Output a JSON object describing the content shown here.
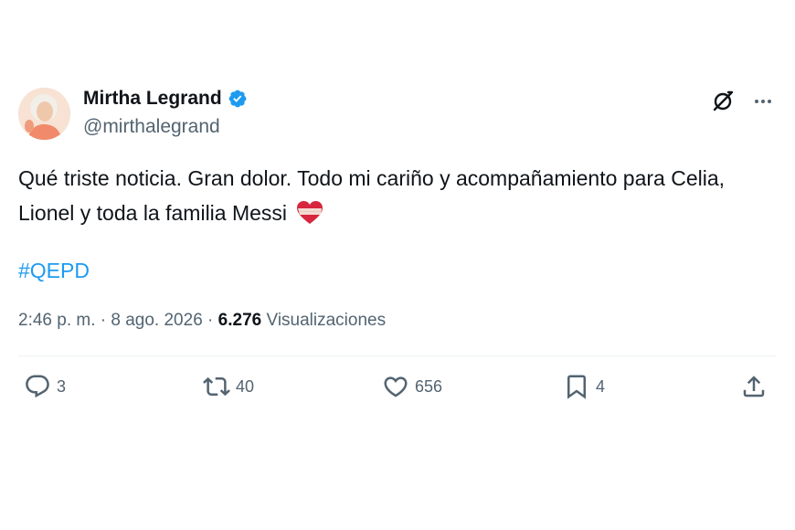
{
  "author": {
    "display_name": "Mirtha Legrand",
    "handle": "@mirthalegrand",
    "verified": true
  },
  "tweet": {
    "text": "Qué triste noticia. Gran dolor. Todo mi cariño y acompañamiento para Celia, Lionel y toda la familia Messi",
    "emoji": "red-heart-with-bandage",
    "hashtag": "#QEPD"
  },
  "meta": {
    "time": "2:46 p. m.",
    "separator": "·",
    "date": "8 ago. 2026",
    "views_count": "6.276",
    "views_label": "Visualizaciones"
  },
  "actions": {
    "replies": "3",
    "retweets": "40",
    "likes": "656",
    "bookmarks": "4"
  },
  "icons": [
    "verified-badge-icon",
    "grok-icon",
    "more-icon",
    "reply-icon",
    "retweet-icon",
    "like-icon",
    "bookmark-icon",
    "share-icon"
  ],
  "colors": {
    "link": "#1d9bf0",
    "secondary_text": "#536471",
    "primary_text": "#0f1419",
    "verified": "#1d9bf0"
  }
}
